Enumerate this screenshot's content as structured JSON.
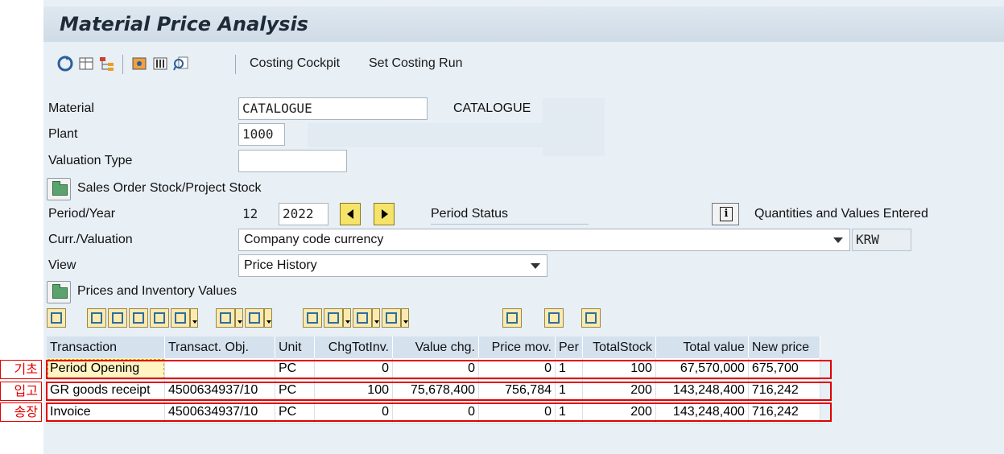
{
  "title": "Material Price Analysis",
  "toolbar": {
    "icons": [
      "refresh-icon",
      "layout-icon",
      "hierarchy-icon",
      "valuation-icon",
      "columns-icon",
      "search-doc-icon"
    ],
    "costing_cockpit": "Costing Cockpit",
    "set_costing_run": "Set Costing Run"
  },
  "form": {
    "material_label": "Material",
    "material_value": "CATALOGUE",
    "material_desc": "CATALOGUE",
    "plant_label": "Plant",
    "plant_value": "1000",
    "valuation_type_label": "Valuation Type",
    "valuation_type_value": "",
    "sales_order_button": "Sales Order Stock/Project Stock",
    "period_year_label": "Period/Year",
    "period_value": "12",
    "year_value": "2022",
    "period_status_label": "Period Status",
    "quantities_label": "Quantities and Values Entered",
    "curr_label": "Curr./Valuation",
    "curr_value": "Company code currency",
    "currency_code": "KRW",
    "view_label": "View",
    "view_value": "Price History",
    "prices_inventory_button": "Prices and Inventory Values"
  },
  "grid": {
    "columns": [
      "Transaction",
      "Transact. Obj.",
      "Unit",
      "ChgTotInv.",
      "Value chg.",
      "Price mov.",
      "Per",
      "TotalStock",
      "Total value",
      "New price"
    ],
    "rows": [
      [
        "Period Opening",
        "",
        "PC",
        "0",
        "0",
        "0",
        "1",
        "100",
        "67,570,000",
        "675,700"
      ],
      [
        "GR goods receipt",
        "4500634937/10",
        "PC",
        "100",
        "75,678,400",
        "756,784",
        "1",
        "200",
        "143,248,400",
        "716,242"
      ],
      [
        "Invoice",
        "4500634937/10",
        "PC",
        "0",
        "0",
        "0",
        "1",
        "200",
        "143,248,400",
        "716,242"
      ]
    ]
  },
  "annotations": [
    "기초",
    "입고",
    "송장"
  ],
  "colors": {
    "background": "#e8eff5",
    "header": "#d5e2ee",
    "annotation": "#e00000",
    "nav_button": "#f6e36a"
  }
}
